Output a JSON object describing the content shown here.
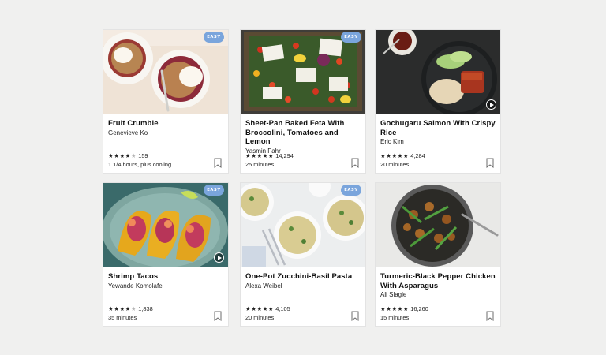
{
  "cards": [
    {
      "title": "Fruit Crumble",
      "author": "Genevieve Ko",
      "stars_filled": 4,
      "stars_text": "★★★★",
      "stars_off_text": "★",
      "rating_count": "159",
      "time": "1 1/4 hours, plus cooling",
      "badge": "EASY",
      "image": "fruit-crumble-photo"
    },
    {
      "title": "Sheet-Pan Baked Feta With Broccolini, Tomatoes and Lemon",
      "author": "Yasmin Fahr",
      "stars_filled": 5,
      "stars_text": "★★★★★",
      "stars_off_text": "",
      "rating_count": "14,294",
      "time": "25 minutes",
      "badge": "EASY",
      "image": "baked-feta-photo"
    },
    {
      "title": "Gochugaru Salmon With Crispy Rice",
      "author": "Eric Kim",
      "stars_filled": 5,
      "stars_text": "★★★★★",
      "stars_off_text": "",
      "rating_count": "4,284",
      "time": "20 minutes",
      "image": "salmon-photo",
      "video": true
    },
    {
      "title": "Shrimp Tacos",
      "author": "Yewande Komolafe",
      "stars_filled": 4,
      "stars_text": "★★★★",
      "stars_off_text": "★",
      "rating_count": "1,838",
      "time": "35 minutes",
      "badge": "EASY",
      "image": "shrimp-tacos-photo",
      "video": true
    },
    {
      "title": "One-Pot Zucchini-Basil Pasta",
      "author": "Alexa Weibel",
      "stars_filled": 5,
      "stars_text": "★★★★★",
      "stars_off_text": "",
      "rating_count": "4,105",
      "time": "20 minutes",
      "badge": "EASY",
      "image": "zucchini-pasta-photo"
    },
    {
      "title": "Turmeric-Black Pepper Chicken With Asparagus",
      "author": "Ali Slagle",
      "stars_filled": 5,
      "stars_text": "★★★★★",
      "stars_off_text": "",
      "rating_count": "16,260",
      "time": "15 minutes",
      "image": "turmeric-chicken-photo"
    }
  ],
  "colors": {
    "badge": "#7aa5dc",
    "page_background": "#f0f0ef",
    "card_background": "#ffffff"
  },
  "icons": {
    "save": "bookmark-icon",
    "video": "play-icon"
  }
}
